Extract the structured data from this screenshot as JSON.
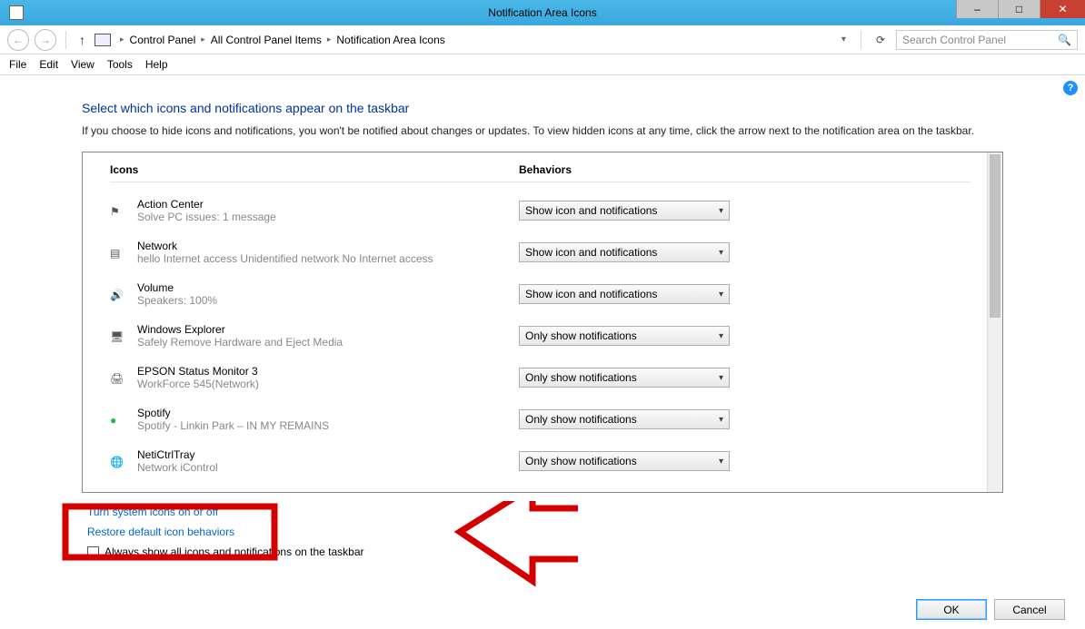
{
  "window": {
    "title": "Notification Area Icons",
    "minimize": "–",
    "maximize": "□",
    "close": "✕"
  },
  "nav": {
    "back_glyph": "←",
    "forward_glyph": "→",
    "up_glyph": "↑",
    "dropdown_glyph": "▾",
    "refresh_glyph": "⟳",
    "search_placeholder": "Search Control Panel",
    "search_glyph": "🔍",
    "crumb_sep": "▸",
    "crumbs": [
      "Control Panel",
      "All Control Panel Items",
      "Notification Area Icons"
    ]
  },
  "menu": {
    "file": "File",
    "edit": "Edit",
    "view": "View",
    "tools": "Tools",
    "help": "Help"
  },
  "page": {
    "help_glyph": "?",
    "heading": "Select which icons and notifications appear on the taskbar",
    "subtext": "If you choose to hide icons and notifications, you won't be notified about changes or updates. To view hidden icons at any time, click the arrow next to the notification area on the taskbar.",
    "col_icons": "Icons",
    "col_behaviors": "Behaviors",
    "link_system_icons": "Turn system icons on or off",
    "link_restore": "Restore default icon behaviors",
    "checkbox_label": "Always show all icons and notifications on the taskbar",
    "ok": "OK",
    "cancel": "Cancel"
  },
  "behaviors": {
    "show": "Show icon and notifications",
    "only": "Only show notifications"
  },
  "items": [
    {
      "icon": "⚑",
      "title": "Action Center",
      "sub": "Solve PC issues: 1 message",
      "behavior": "show"
    },
    {
      "icon": "▤",
      "title": "Network",
      "sub": "hello Internet access  Unidentified network No Internet access",
      "behavior": "show"
    },
    {
      "icon": "🔊",
      "title": "Volume",
      "sub": "Speakers: 100%",
      "behavior": "show"
    },
    {
      "icon": "🖥",
      "title": "Windows Explorer",
      "sub": "Safely Remove Hardware and Eject Media",
      "behavior": "only"
    },
    {
      "icon": "🖨",
      "title": "EPSON Status Monitor 3",
      "sub": "WorkForce 545(Network)",
      "behavior": "only"
    },
    {
      "icon": "●",
      "title": "Spotify",
      "sub": "Spotify - Linkin Park – IN MY REMAINS",
      "behavior": "only"
    },
    {
      "icon": "🌐",
      "title": "NetiCtrlTray",
      "sub": "Network iControl",
      "behavior": "only"
    }
  ]
}
